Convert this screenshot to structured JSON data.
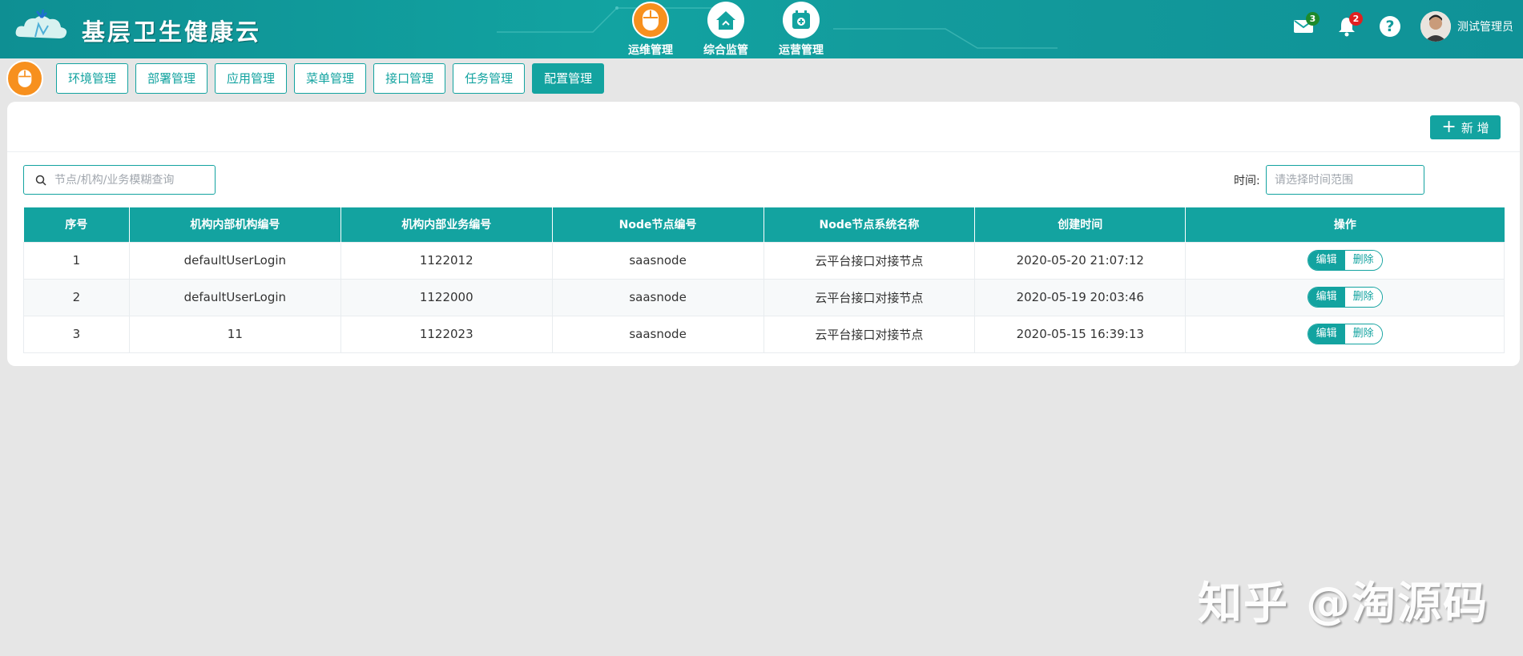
{
  "header": {
    "brand": "基层卫生健康云",
    "nav": [
      {
        "label": "运维管理",
        "icon": "mouse-icon",
        "active": true
      },
      {
        "label": "综合监管",
        "icon": "house-icon",
        "active": false
      },
      {
        "label": "运营管理",
        "icon": "calendar-plus-icon",
        "active": false
      }
    ],
    "mail_count": "3",
    "notify_count": "2",
    "help": "?",
    "username": "测试管理员"
  },
  "subnav": {
    "tabs": [
      {
        "label": "环境管理"
      },
      {
        "label": "部署管理"
      },
      {
        "label": "应用管理"
      },
      {
        "label": "菜单管理"
      },
      {
        "label": "接口管理"
      },
      {
        "label": "任务管理"
      },
      {
        "label": "配置管理"
      }
    ],
    "active_index": 6
  },
  "toolbar": {
    "plus": "+",
    "add_label": "新 增",
    "search_placeholder": "节点/机构/业务模糊查询",
    "time_label": "时间:",
    "time_placeholder": "请选择时间范围"
  },
  "table": {
    "headers": [
      "序号",
      "机构内部机构编号",
      "机构内部业务编号",
      "Node节点编号",
      "Node节点系统名称",
      "创建时间",
      "操作"
    ],
    "rows": [
      {
        "no": "1",
        "org_code": "defaultUserLogin",
        "biz_code": "1122012",
        "node_code": "saasnode",
        "node_name": "云平台接口对接节点",
        "created": "2020-05-20 21:07:12"
      },
      {
        "no": "2",
        "org_code": "defaultUserLogin",
        "biz_code": "1122000",
        "node_code": "saasnode",
        "node_name": "云平台接口对接节点",
        "created": "2020-05-19 20:03:46"
      },
      {
        "no": "3",
        "org_code": "11",
        "biz_code": "1122023",
        "node_code": "saasnode",
        "node_name": "云平台接口对接节点",
        "created": "2020-05-15 16:39:13"
      }
    ],
    "edit_label": "编辑",
    "delete_label": "删除"
  },
  "watermark": "知乎 @淘源码",
  "colors": {
    "accent": "#13a3a0",
    "orange": "#f7901e",
    "bg": "#e6e6e6"
  }
}
